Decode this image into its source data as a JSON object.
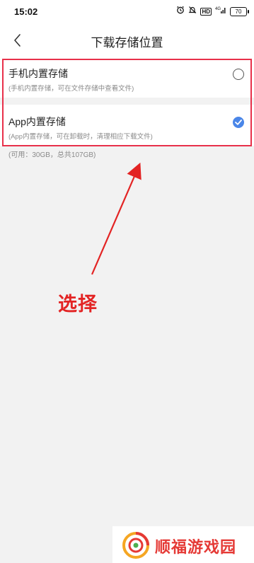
{
  "status_bar": {
    "time": "15:02",
    "hd": "HD",
    "network": "4G",
    "battery": "70"
  },
  "header": {
    "title": "下载存储位置"
  },
  "options": [
    {
      "label": "手机内置存储",
      "description": "(手机内置存储，可在文件存储中查看文件)",
      "selected": false
    },
    {
      "label": "App内置存储",
      "description": "(App内置存储，可在卸载时，清理相应下载文件)",
      "selected": true
    }
  ],
  "storage_info": "(可用：30GB，总共107GB)",
  "annotation": {
    "text": "选择",
    "color": "#e32424"
  },
  "watermark": {
    "text": "顺福游戏园"
  },
  "colors": {
    "accent": "#4a86e8",
    "highlight": "#e8304a"
  }
}
